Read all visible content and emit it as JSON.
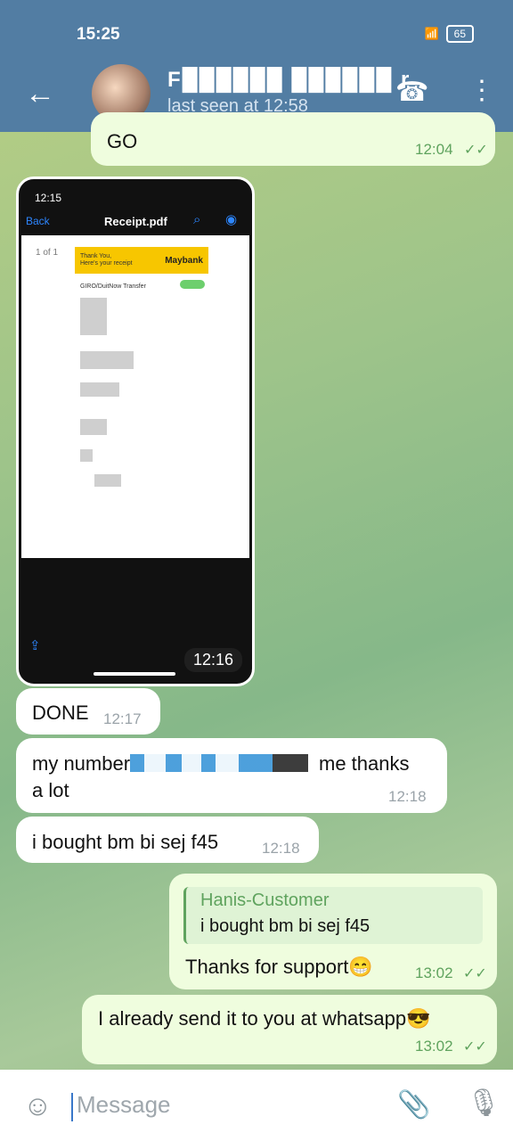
{
  "status": {
    "time": "15:25",
    "battery": "65"
  },
  "appbar": {
    "name": "F██████ ██████ r",
    "status": "last seen at 12:58"
  },
  "messages": [
    {
      "side": "out",
      "text": "GO",
      "time": "12:04"
    },
    {
      "side": "in",
      "time": "12:16",
      "screenshot": {
        "time": "12:15",
        "back": "Back",
        "title": "Receipt.pdf",
        "page": "1 of 1",
        "thank_you": "Thank You,",
        "receipt_label": "Here's your receipt",
        "brand": "Maybank",
        "transfer_type": "GIRO/DuitNow Transfer",
        "status": "Successful"
      }
    },
    {
      "side": "in",
      "text": "DONE",
      "time": "12:17"
    },
    {
      "side": "in",
      "text_line1": "my number",
      "text_line1b": "me thanks",
      "text_line2": "a lot",
      "time": "12:18"
    },
    {
      "side": "in",
      "text": "i bought bm bi sej f45",
      "time": "12:18"
    },
    {
      "side": "out",
      "reply_name": "Hanis-Customer",
      "reply_text": "i bought bm bi sej f45",
      "text": "Thanks for support😁",
      "time": "13:02"
    },
    {
      "side": "out",
      "text": "I already send it to you at whatsapp😎",
      "time": "13:02"
    }
  ],
  "composer": {
    "placeholder": "Message"
  },
  "icons": [
    "back-arrow-icon",
    "call-icon",
    "more-icon",
    "emoji-icon",
    "attach-icon",
    "mic-icon",
    "read-receipt-icon"
  ]
}
